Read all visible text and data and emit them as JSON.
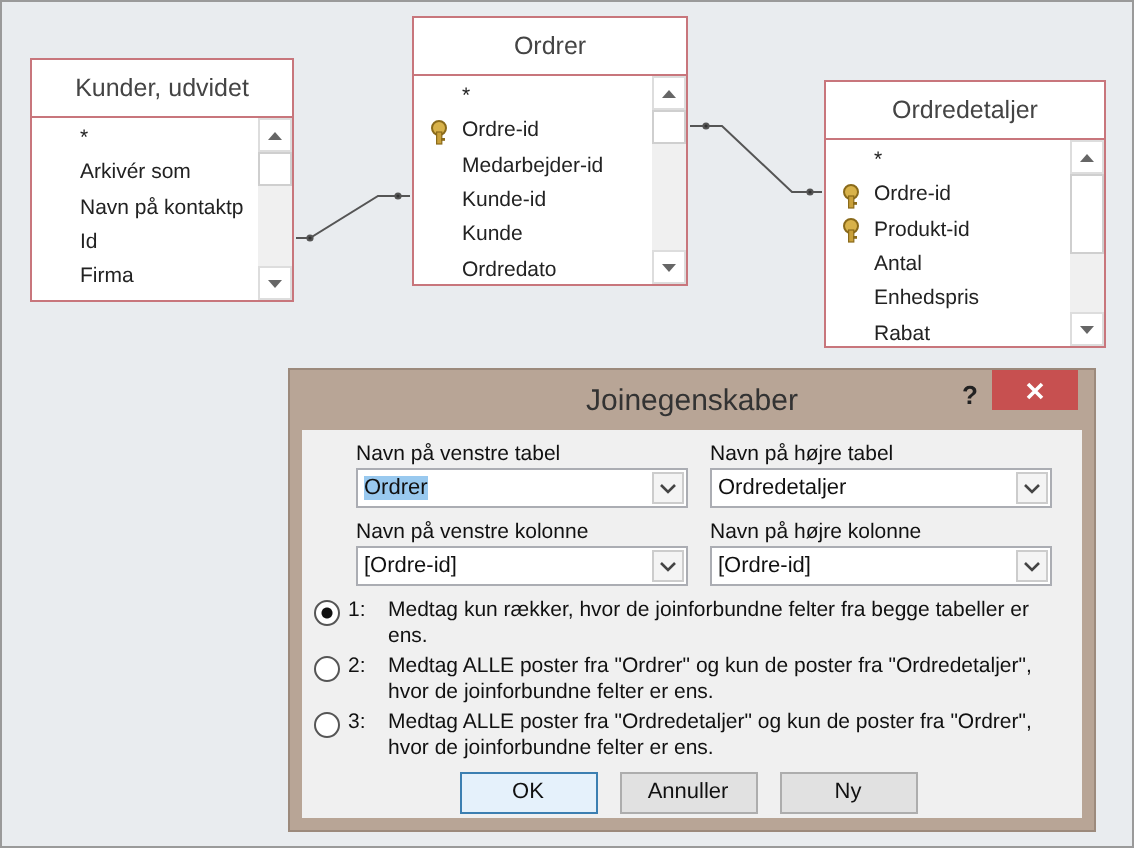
{
  "tables": [
    {
      "title": "Kunder, udvidet",
      "fields": [
        {
          "name": "*",
          "key": false
        },
        {
          "name": "Arkivér som",
          "key": false
        },
        {
          "name": "Navn på kontaktp",
          "key": false
        },
        {
          "name": "Id",
          "key": false
        },
        {
          "name": "Firma",
          "key": false
        }
      ]
    },
    {
      "title": "Ordrer",
      "fields": [
        {
          "name": "*",
          "key": false
        },
        {
          "name": "Ordre-id",
          "key": true
        },
        {
          "name": "Medarbejder-id",
          "key": false
        },
        {
          "name": "Kunde-id",
          "key": false
        },
        {
          "name": "Kunde",
          "key": false
        },
        {
          "name": "Ordredato",
          "key": false
        }
      ]
    },
    {
      "title": "Ordredetaljer",
      "fields": [
        {
          "name": "*",
          "key": false
        },
        {
          "name": "Ordre-id",
          "key": true
        },
        {
          "name": "Produkt-id",
          "key": true
        },
        {
          "name": "Antal",
          "key": false
        },
        {
          "name": "Enhedspris",
          "key": false
        },
        {
          "name": "Rabat",
          "key": false
        }
      ]
    }
  ],
  "dialog": {
    "title": "Joinegenskaber",
    "help": "?",
    "fields": [
      {
        "label": "Navn på venstre tabel",
        "value": "Ordrer",
        "highlighted": true
      },
      {
        "label": "Navn på højre tabel",
        "value": "Ordredetaljer",
        "highlighted": false
      },
      {
        "label": "Navn på venstre kolonne",
        "value": "[Ordre-id]",
        "highlighted": false
      },
      {
        "label": "Navn på højre kolonne",
        "value": "[Ordre-id]",
        "highlighted": false
      }
    ],
    "options": [
      {
        "number": "1:",
        "text": "Medtag kun rækker, hvor de joinforbundne felter fra begge tabeller er ens.",
        "selected": true
      },
      {
        "number": "2:",
        "text": "Medtag ALLE poster fra \"Ordrer\" og kun de poster fra \"Ordredetaljer\", hvor de joinforbundne felter er ens.",
        "selected": false
      },
      {
        "number": "3:",
        "text": "Medtag ALLE poster fra \"Ordredetaljer\" og kun de poster fra \"Ordrer\", hvor de joinforbundne felter er ens.",
        "selected": false
      }
    ],
    "buttons": [
      {
        "label": "OK",
        "default": true
      },
      {
        "label": "Annuller",
        "default": false
      },
      {
        "label": "Ny",
        "default": false
      }
    ]
  }
}
